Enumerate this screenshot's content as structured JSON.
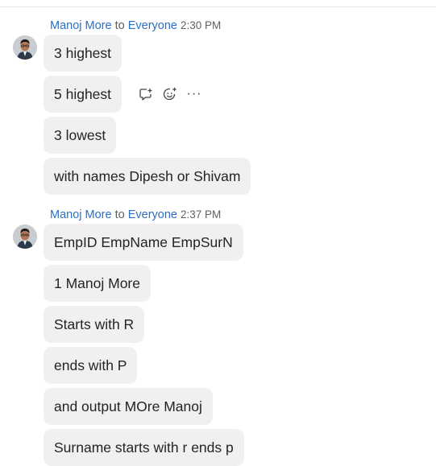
{
  "messages": [
    {
      "sender": "Manoj More",
      "to_word": "to",
      "recipient": "Everyone",
      "time": "2:30 PM",
      "lines": [
        "3 highest",
        "5 highest",
        "3 lowest",
        "with names Dipesh or Shivam"
      ]
    },
    {
      "sender": "Manoj More",
      "to_word": "to",
      "recipient": "Everyone",
      "time": "2:37 PM",
      "lines": [
        "EmpID EmpName EmpSurN",
        "1 Manoj More",
        "Starts with R",
        "ends with P",
        "and output MOre Manoj",
        "Surname starts with r ends p"
      ]
    }
  ],
  "hover_actions": {
    "icons": [
      "reply-icon",
      "add-reaction-icon",
      "more-options-icon"
    ],
    "more_label": "···"
  }
}
